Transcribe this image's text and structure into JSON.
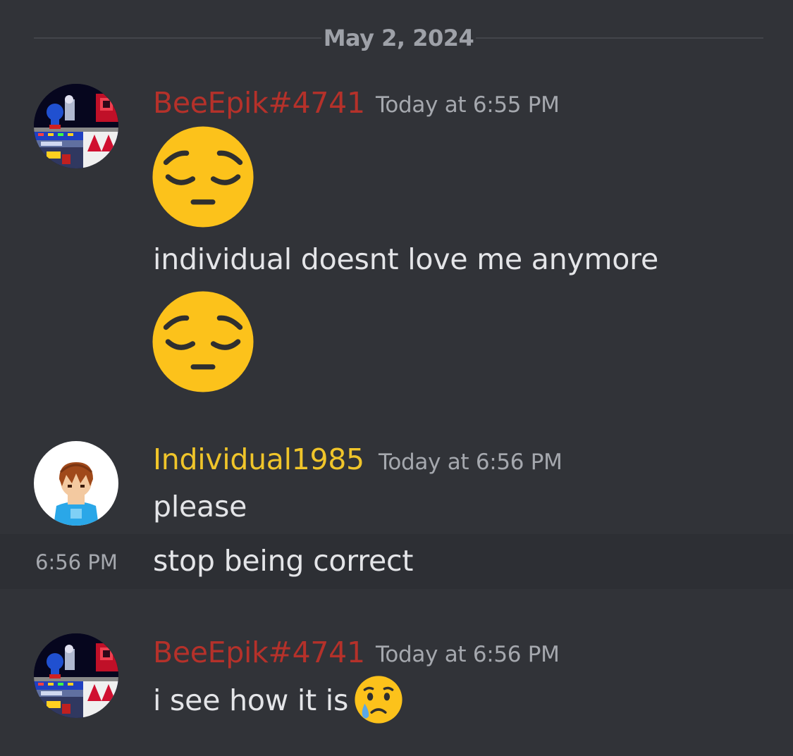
{
  "date_divider": "May 2, 2024",
  "messages": [
    {
      "author": "BeeEpik#4741",
      "timestamp": "Today at 6:55 PM",
      "avatar": "sonic-pixel-art-avatar",
      "lines": [
        "individual doesnt love me anymore"
      ],
      "emojis": [
        "pensive-face-emoji",
        "pensive-face-emoji"
      ]
    },
    {
      "author": "Individual1985",
      "timestamp": "Today at 6:56 PM",
      "avatar": "cartoon-boy-avatar",
      "lines": [
        "please"
      ]
    },
    {
      "side_time": "6:56 PM",
      "lines": [
        "stop being correct"
      ]
    },
    {
      "author": "BeeEpik#4741",
      "timestamp": "Today at 6:56 PM",
      "avatar": "sonic-pixel-art-avatar",
      "lines": [
        "i see how it is"
      ],
      "emojis": [
        "crying-face-emoji"
      ]
    }
  ],
  "colors": {
    "background": "#313338",
    "bee_name": "#b5312a",
    "individual_name": "#f0c52a",
    "text": "#e4e5e8",
    "muted": "#a5a8ae"
  }
}
